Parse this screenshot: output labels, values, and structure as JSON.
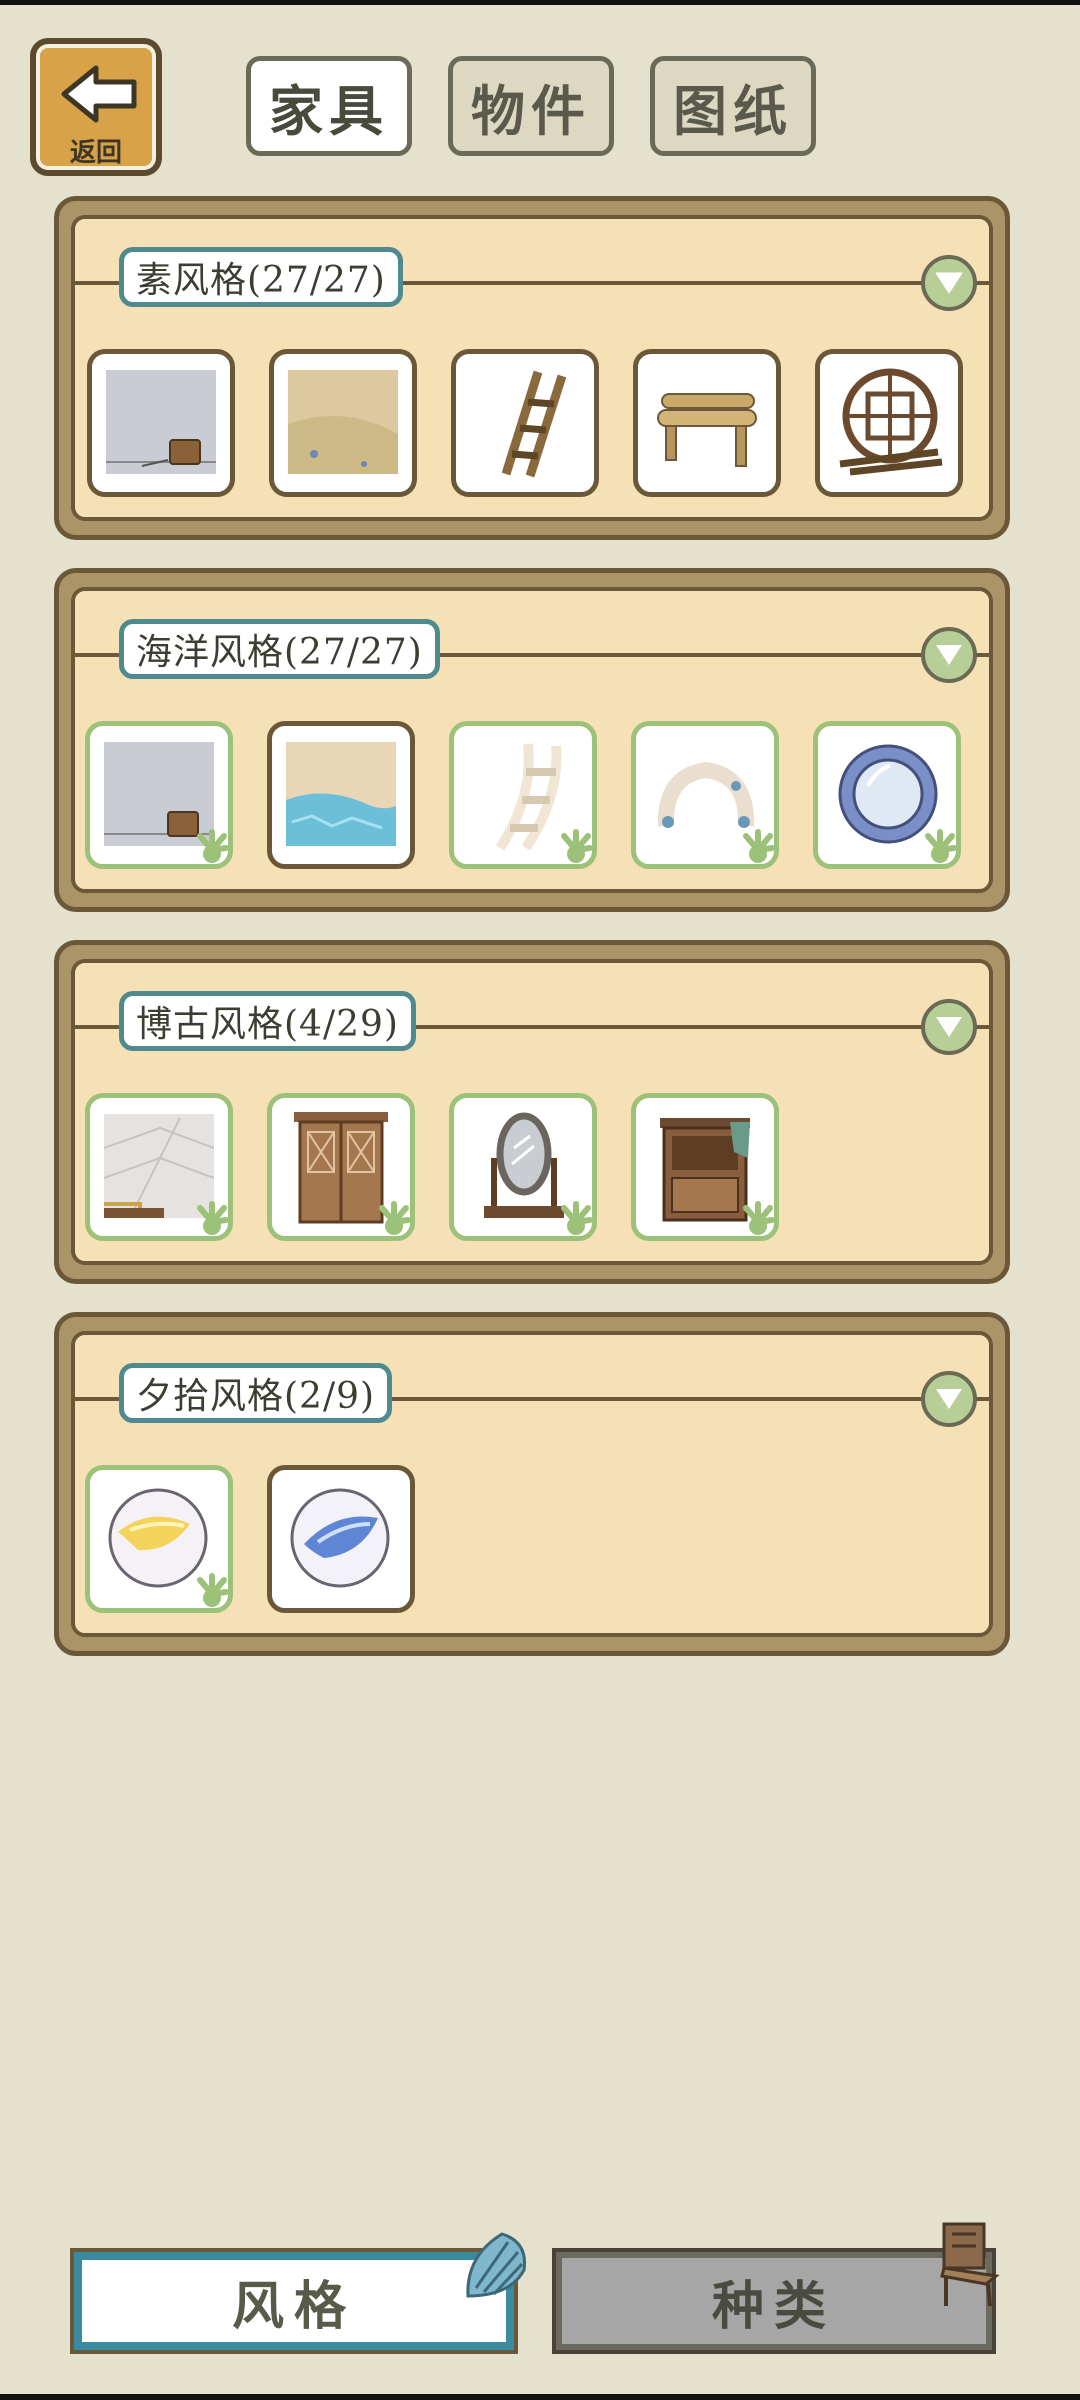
{
  "header": {
    "back_label": "返回",
    "tabs": [
      {
        "label": "家具",
        "active": true
      },
      {
        "label": "物件",
        "active": false
      },
      {
        "label": "图纸",
        "active": false
      }
    ]
  },
  "sections": [
    {
      "title": "素风格(27/27)",
      "items": [
        "wall-bucket",
        "sand-floor",
        "wooden-ladder",
        "log-bench",
        "lattice-window"
      ]
    },
    {
      "title": "海洋风格(27/27)",
      "items": [
        "wall-bucket",
        "pool-floor",
        "white-ladder",
        "shell-arch",
        "porthole-mirror"
      ]
    },
    {
      "title": "博古风格(4/29)",
      "items": [
        "tile-floor",
        "lattice-door",
        "standing-mirror",
        "wooden-cabinet"
      ]
    },
    {
      "title": "夕拾风格(2/9)",
      "items": [
        "yellow-marble",
        "blue-marble"
      ]
    }
  ],
  "bottom_tabs": [
    {
      "label": "风格",
      "active": true
    },
    {
      "label": "种类",
      "active": false
    }
  ],
  "colors": {
    "background": "#e4e1cc",
    "panel_fill": "#f6e0b5",
    "panel_border": "#6b5838",
    "title_border": "#4e8a8f",
    "owned_border": "#9cc27a",
    "active_tab_border": "#3a8aa0"
  }
}
